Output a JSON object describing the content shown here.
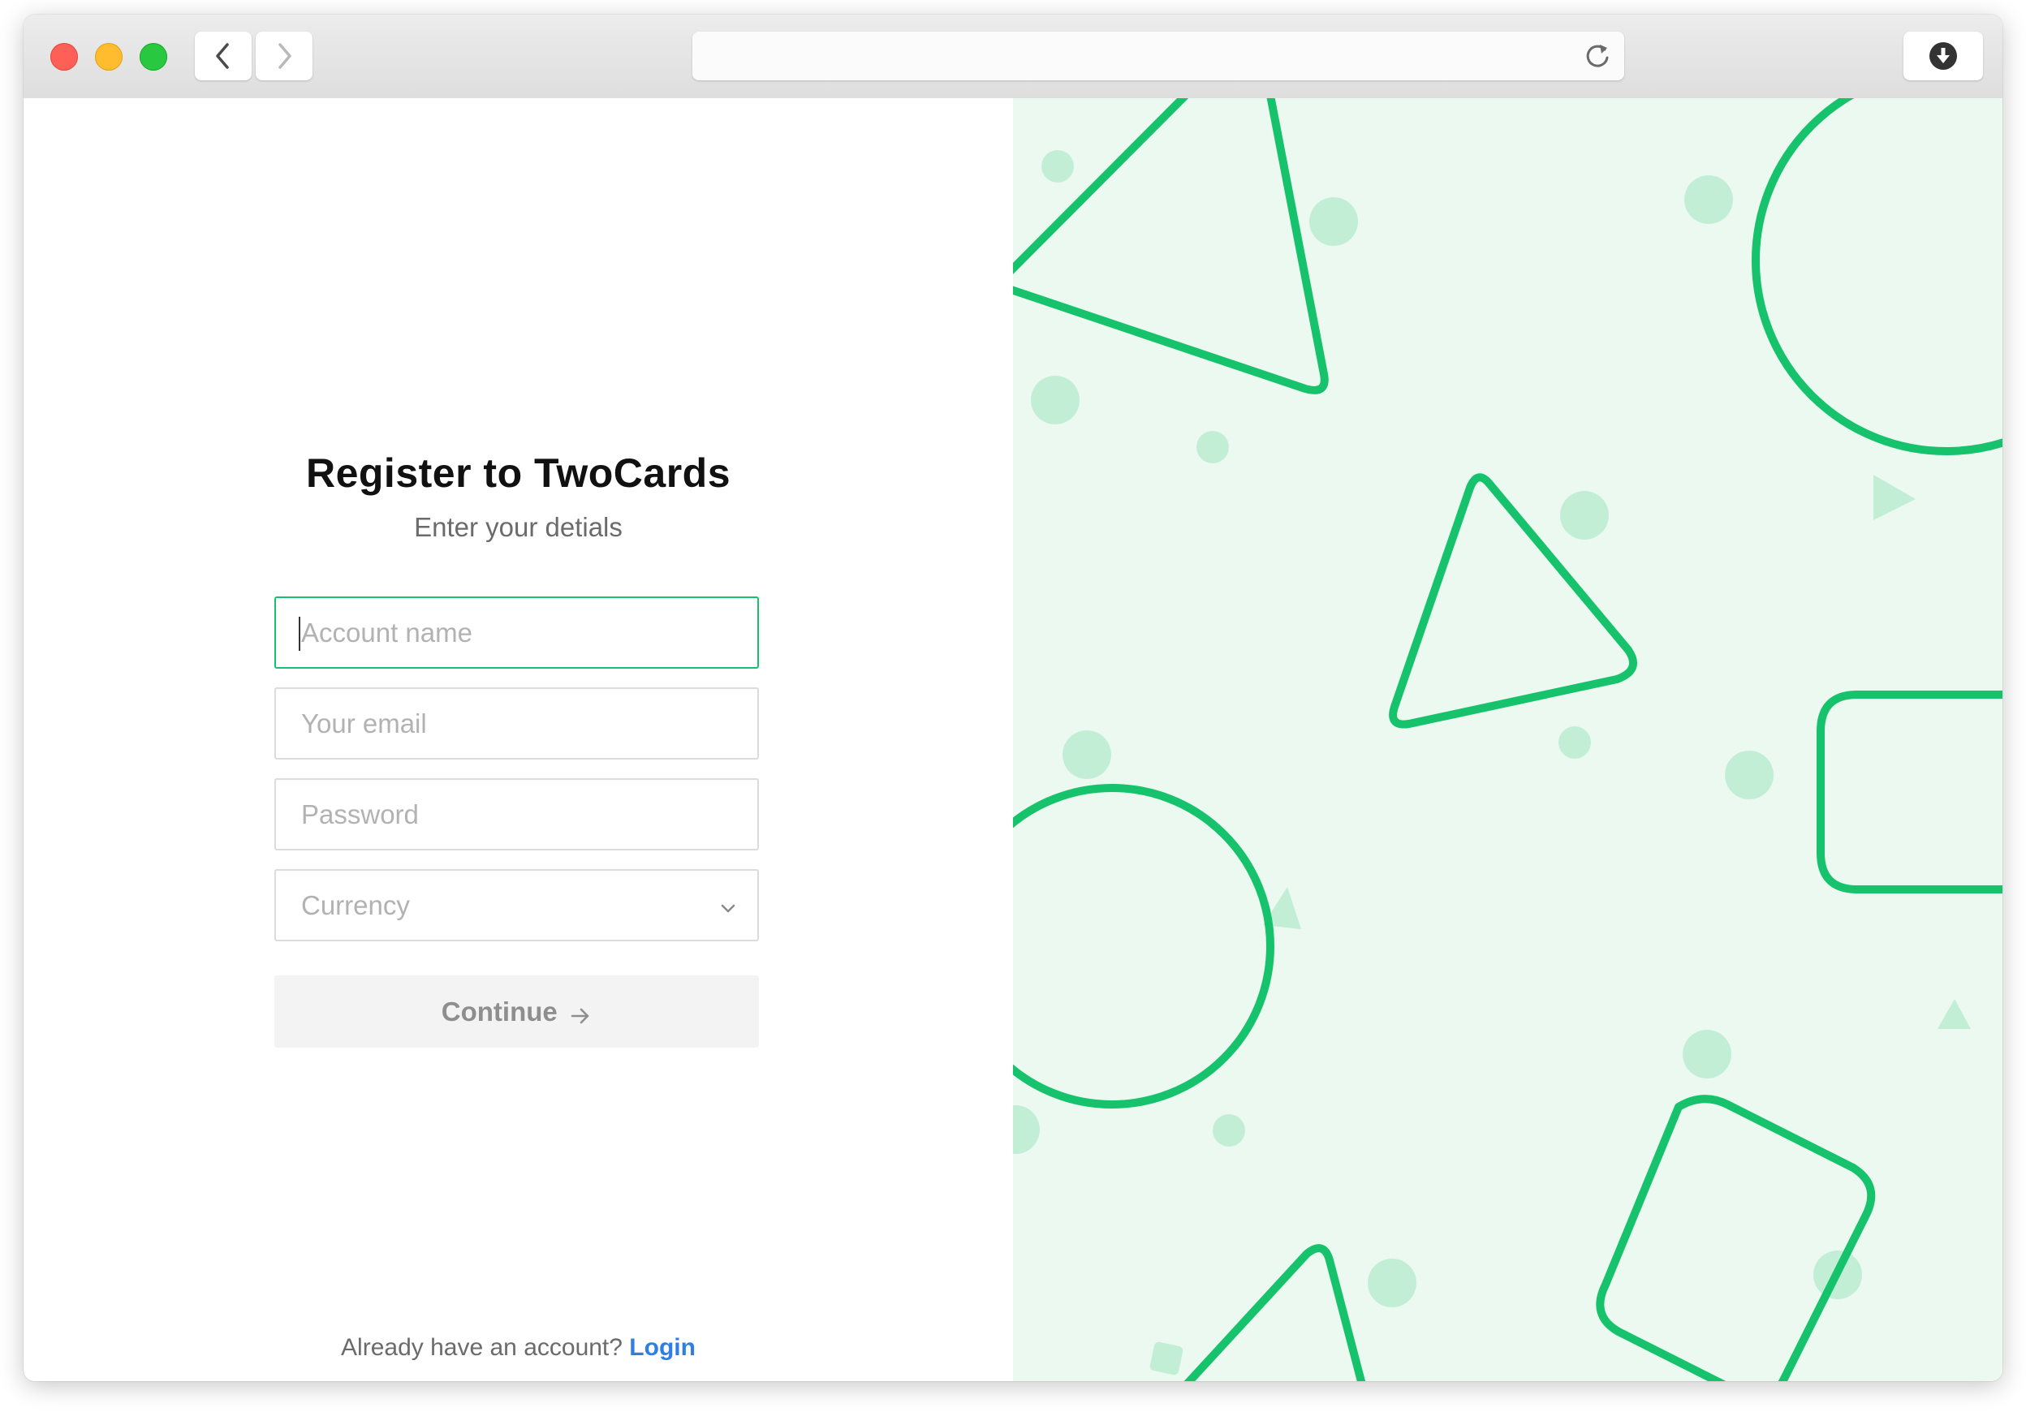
{
  "browser": {
    "url": "",
    "icons": {
      "back": "chevron-left-icon",
      "forward": "chevron-right-icon",
      "reload": "reload-icon",
      "download": "download-icon"
    }
  },
  "form": {
    "title": "Register to TwoCards",
    "subtitle": "Enter your detials",
    "account_name": {
      "placeholder": "Account name",
      "value": ""
    },
    "email": {
      "placeholder": "Your email",
      "value": ""
    },
    "password": {
      "placeholder": "Password",
      "value": ""
    },
    "currency": {
      "placeholder": "Currency"
    },
    "continue_label": "Continue"
  },
  "footer": {
    "prompt": "Already have an account?",
    "login_label": "Login"
  },
  "colors": {
    "accent": "#16c26b",
    "link": "#2f7ee6",
    "pattern_bg": "#ebf9f0",
    "pattern_dots": "#c3eed6"
  }
}
